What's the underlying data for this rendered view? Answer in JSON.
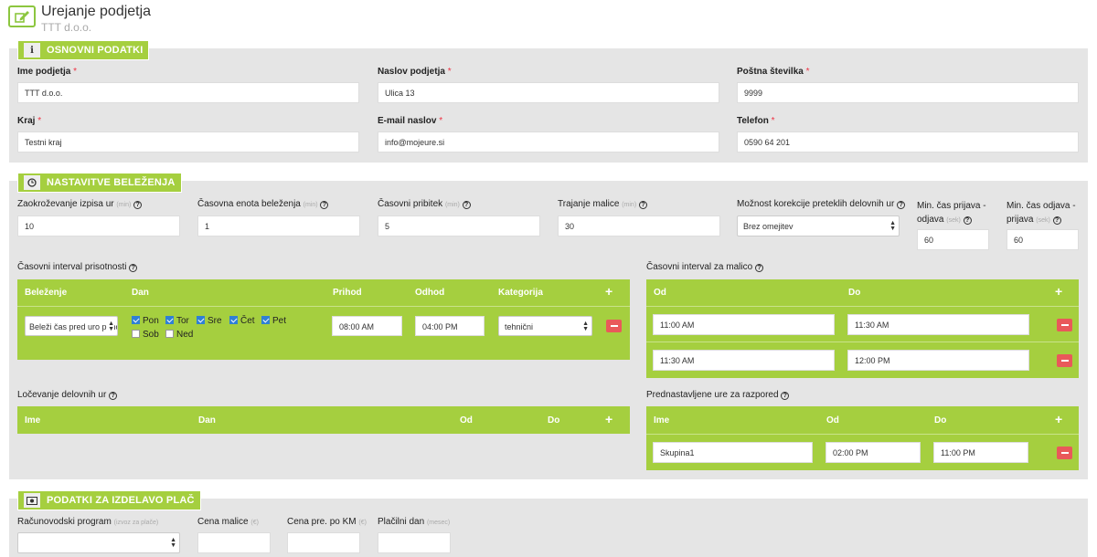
{
  "header": {
    "title": "Urejanje podjetja",
    "subtitle": "TTT d.o.o."
  },
  "colors": {
    "accent": "#a5cf3f",
    "danger": "#e9595a",
    "panel": "#e5e5e5",
    "required": "#e34",
    "checkbox": "#2f80d5"
  },
  "icons": {
    "header": "edit-icon",
    "basic": "info-icon",
    "tracking": "clock-icon",
    "payroll": "money-icon",
    "help": "question-circle-icon",
    "add": "plus-icon",
    "remove": "minus-icon"
  },
  "basic": {
    "title": "OSNOVNI PODATKI",
    "info_glyph": "i",
    "name_label": "Ime podjetja",
    "name_value": "TTT d.o.o.",
    "address_label": "Naslov podjetja",
    "address_value": "Ulica 13",
    "postal_label": "Poštna številka",
    "postal_value": "9999",
    "city_label": "Kraj",
    "city_value": "Testni kraj",
    "email_label": "E-mail naslov",
    "email_value": "info@mojeure.si",
    "phone_label": "Telefon",
    "phone_value": "0590 64 201"
  },
  "tracking": {
    "title": "NASTAVITVE BELEŽENJA",
    "rounding_label": "Zaokroževanje izpisa ur",
    "rounding_unit": "(min)",
    "rounding_value": "10",
    "unit_label": "Časovna enota beleženja",
    "unit_unit": "(min)",
    "unit_value": "1",
    "surcharge_label": "Časovni pribitek",
    "surcharge_unit": "(min)",
    "surcharge_value": "5",
    "lunch_label": "Trajanje malice",
    "lunch_unit": "(min)",
    "lunch_value": "30",
    "correction_label": "Možnost korekcije preteklih delovnih ur",
    "correction_value": "Brez omejitev",
    "min_login_label_1": "Min. čas prijava -",
    "min_login_label_2": "odjava",
    "min_login_unit": "(sek)",
    "min_login_value": "60",
    "min_logout_label_1": "Min. čas odjava -",
    "min_logout_label_2": "prijava",
    "min_logout_unit": "(sek)",
    "min_logout_value": "60",
    "presence": {
      "label": "Časovni interval prisotnosti",
      "headers": {
        "tracking": "Beleženje",
        "day": "Dan",
        "arrival": "Prihod",
        "departure": "Odhod",
        "category": "Kategorija"
      },
      "row": {
        "tracking": "Beleži čas pred uro prihoda",
        "days": {
          "pon": "Pon",
          "tor": "Tor",
          "sre": "Sre",
          "cet": "Čet",
          "pet": "Pet",
          "sob": "Sob",
          "ned": "Ned"
        },
        "arrival": "08:00 AM",
        "departure": "04:00 PM",
        "category": "tehnični"
      }
    },
    "lunch_interval": {
      "label": "Časovni interval za malico",
      "headers": {
        "from": "Od",
        "to": "Do"
      },
      "rows": [
        {
          "from": "11:00 AM",
          "to": "11:30 AM"
        },
        {
          "from": "11:30 AM",
          "to": "12:00 PM"
        }
      ]
    },
    "separation": {
      "label": "Ločevanje delovnih ur",
      "headers": {
        "name": "Ime",
        "day": "Dan",
        "from": "Od",
        "to": "Do"
      }
    },
    "preset": {
      "label": "Prednastavljene ure za razpored",
      "headers": {
        "name": "Ime",
        "from": "Od",
        "to": "Do"
      },
      "row": {
        "name": "Skupina1",
        "from": "02:00 PM",
        "to": "11:00 PM"
      }
    }
  },
  "payroll": {
    "title": "PODATKI ZA IZDELAVO PLAČ",
    "program_label": "Računovodski program",
    "program_unit": "(izvoz za plače)",
    "program_value": "",
    "lunch_price_label": "Cena malice",
    "lunch_price_unit": "(€)",
    "lunch_price_value": "",
    "km_price_label": "Cena pre. po KM",
    "km_price_unit": "(€)",
    "km_price_value": "",
    "payday_label": "Plačilni dan",
    "payday_unit": "(mesec)",
    "payday_value": ""
  },
  "ui": {
    "plus": "+",
    "help": "?",
    "arrow_up": "▲",
    "arrow_down": "▼"
  }
}
